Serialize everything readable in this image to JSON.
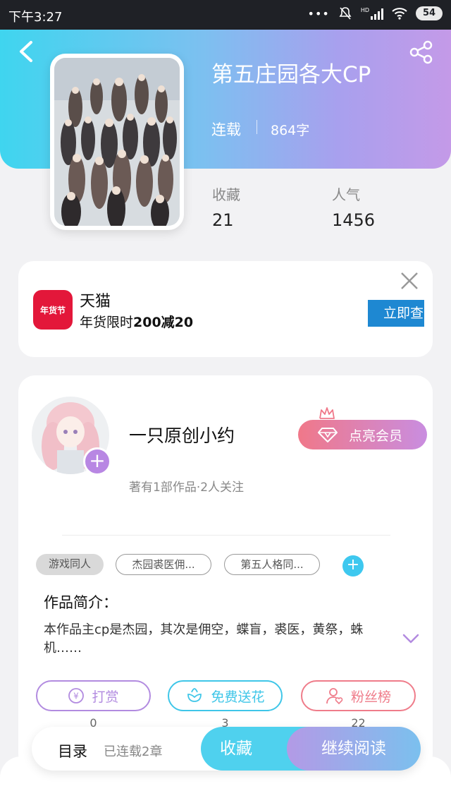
{
  "status_bar": {
    "time": "下午3:27",
    "signal_label": "HD",
    "battery": "54"
  },
  "book": {
    "title": "第五庄园各大CP",
    "status": "连载",
    "word_count": "864字",
    "stats": {
      "favorites_label": "收藏",
      "favorites_value": "21",
      "popularity_label": "人气",
      "popularity_value": "1456"
    }
  },
  "ad": {
    "logo_text": "年货节",
    "name": "天猫",
    "desc_prefix": "年货限时",
    "desc_highlight": "200减20",
    "button": "立即查"
  },
  "author": {
    "name": "一只原创小约",
    "meta": "著有1部作品·2人关注",
    "follow": "+",
    "vip_button": "点亮会员"
  },
  "tags": [
    "游戏同人",
    "杰园裘医佣...",
    "第五人格同..."
  ],
  "add_tag": "+",
  "intro": {
    "title": "作品简介：",
    "text": "本作品主cp是杰园，其次是佣空，蝶盲，裘医，黄祭，蛛机……"
  },
  "actions": [
    {
      "label": "打赏",
      "count": "0",
      "color": "#b28be0",
      "icon": "coin-icon"
    },
    {
      "label": "免费送花",
      "count": "3",
      "color": "#3fc6e8",
      "icon": "flower-icon"
    },
    {
      "label": "粉丝榜",
      "count": "22",
      "color": "#ef7c8a",
      "icon": "fans-icon"
    }
  ],
  "bottom_bar": {
    "toc": "目录",
    "chapters": "已连载2章",
    "favorite": "收藏",
    "continue_reading": "继续阅读"
  }
}
